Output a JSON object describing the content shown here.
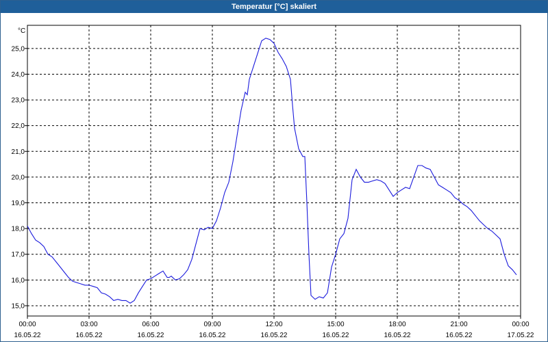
{
  "window": {
    "title": "Temperatur [°C] skaliert"
  },
  "chart_data": {
    "type": "line",
    "title": "Temperatur [°C] skaliert",
    "ylabel": "°C",
    "xlabel": "",
    "ylim": [
      14.6,
      25.9
    ],
    "yticks": [
      15.0,
      16.0,
      17.0,
      18.0,
      19.0,
      20.0,
      21.0,
      22.0,
      23.0,
      24.0,
      25.0
    ],
    "ytick_labels": [
      "15,0",
      "16,0",
      "17,0",
      "18,0",
      "19,0",
      "20,0",
      "21,0",
      "22,0",
      "23,0",
      "24,0",
      "25,0"
    ],
    "xlim": [
      0,
      24
    ],
    "xticks": [
      0,
      3,
      6,
      9,
      12,
      15,
      18,
      21,
      24
    ],
    "xtick_labels": [
      {
        "time": "00:00",
        "date": "16.05.22"
      },
      {
        "time": "03:00",
        "date": "16.05.22"
      },
      {
        "time": "06:00",
        "date": "16.05.22"
      },
      {
        "time": "09:00",
        "date": "16.05.22"
      },
      {
        "time": "12:00",
        "date": "16.05.22"
      },
      {
        "time": "15:00",
        "date": "16.05.22"
      },
      {
        "time": "18:00",
        "date": "16.05.22"
      },
      {
        "time": "21:00",
        "date": "16.05.22"
      },
      {
        "time": "00:00",
        "date": "17.05.22"
      }
    ],
    "grid": true,
    "colors": {
      "line": "#1a1adc",
      "grid": "#000000",
      "titlebar": "#1f5f9a"
    },
    "series": [
      {
        "x": [
          0.0,
          0.2,
          0.4,
          0.6,
          0.8,
          1.0,
          1.2,
          1.4,
          1.6,
          1.8,
          2.0,
          2.2,
          2.4,
          2.6,
          2.8,
          3.0,
          3.2,
          3.4,
          3.6,
          3.8,
          4.0,
          4.2,
          4.4,
          4.6,
          4.8,
          5.0,
          5.2,
          5.4,
          5.6,
          5.8,
          6.0,
          6.2,
          6.4,
          6.6,
          6.8,
          6.9,
          7.0,
          7.2,
          7.4,
          7.6,
          7.8,
          8.0,
          8.2,
          8.4,
          8.6,
          8.8,
          9.0,
          9.2,
          9.4,
          9.6,
          9.8,
          10.0,
          10.2,
          10.4,
          10.6,
          10.7,
          10.8,
          11.0,
          11.2,
          11.4,
          11.6,
          11.8,
          12.0,
          12.2,
          12.4,
          12.6,
          12.8,
          12.9,
          13.0,
          13.2,
          13.4,
          13.5,
          13.6,
          13.7,
          13.8,
          14.0,
          14.2,
          14.4,
          14.6,
          14.8,
          15.0,
          15.2,
          15.4,
          15.6,
          15.8,
          16.0,
          16.2,
          16.4,
          16.6,
          16.8,
          17.0,
          17.2,
          17.4,
          17.6,
          17.8,
          18.0,
          18.2,
          18.4,
          18.6,
          18.8,
          19.0,
          19.2,
          19.4,
          19.6,
          19.8,
          20.0,
          20.2,
          20.4,
          20.6,
          20.8,
          21.0,
          21.2,
          21.4,
          21.6,
          21.8,
          22.0,
          22.2,
          22.4,
          22.6,
          22.8,
          23.0,
          23.2,
          23.4,
          23.6,
          23.8
        ],
        "y": [
          18.1,
          17.8,
          17.55,
          17.45,
          17.3,
          17.0,
          16.9,
          16.7,
          16.5,
          16.3,
          16.1,
          15.95,
          15.9,
          15.85,
          15.8,
          15.8,
          15.75,
          15.7,
          15.5,
          15.45,
          15.35,
          15.2,
          15.25,
          15.2,
          15.2,
          15.1,
          15.2,
          15.5,
          15.75,
          16.0,
          16.05,
          16.15,
          16.25,
          16.35,
          16.1,
          16.1,
          16.15,
          16.0,
          16.05,
          16.2,
          16.4,
          16.8,
          17.4,
          18.0,
          17.95,
          18.05,
          18.0,
          18.3,
          18.8,
          19.4,
          19.8,
          20.6,
          21.6,
          22.6,
          23.3,
          23.2,
          23.8,
          24.3,
          24.8,
          25.3,
          25.4,
          25.35,
          25.2,
          24.85,
          24.6,
          24.3,
          23.8,
          22.8,
          21.9,
          21.1,
          20.8,
          20.8,
          19.0,
          17.0,
          15.4,
          15.25,
          15.35,
          15.3,
          15.5,
          16.5,
          17.0,
          17.6,
          17.8,
          18.4,
          19.9,
          20.3,
          20.0,
          19.8,
          19.8,
          19.85,
          19.9,
          19.85,
          19.75,
          19.5,
          19.25,
          19.4,
          19.5,
          19.6,
          19.55,
          20.0,
          20.45,
          20.45,
          20.35,
          20.3,
          20.0,
          19.7,
          19.6,
          19.5,
          19.4,
          19.2,
          19.1,
          18.95,
          18.85,
          18.7,
          18.5,
          18.3,
          18.15,
          18.0,
          17.9,
          17.75,
          17.6,
          17.0,
          16.55,
          16.4,
          16.2
        ]
      }
    ]
  }
}
